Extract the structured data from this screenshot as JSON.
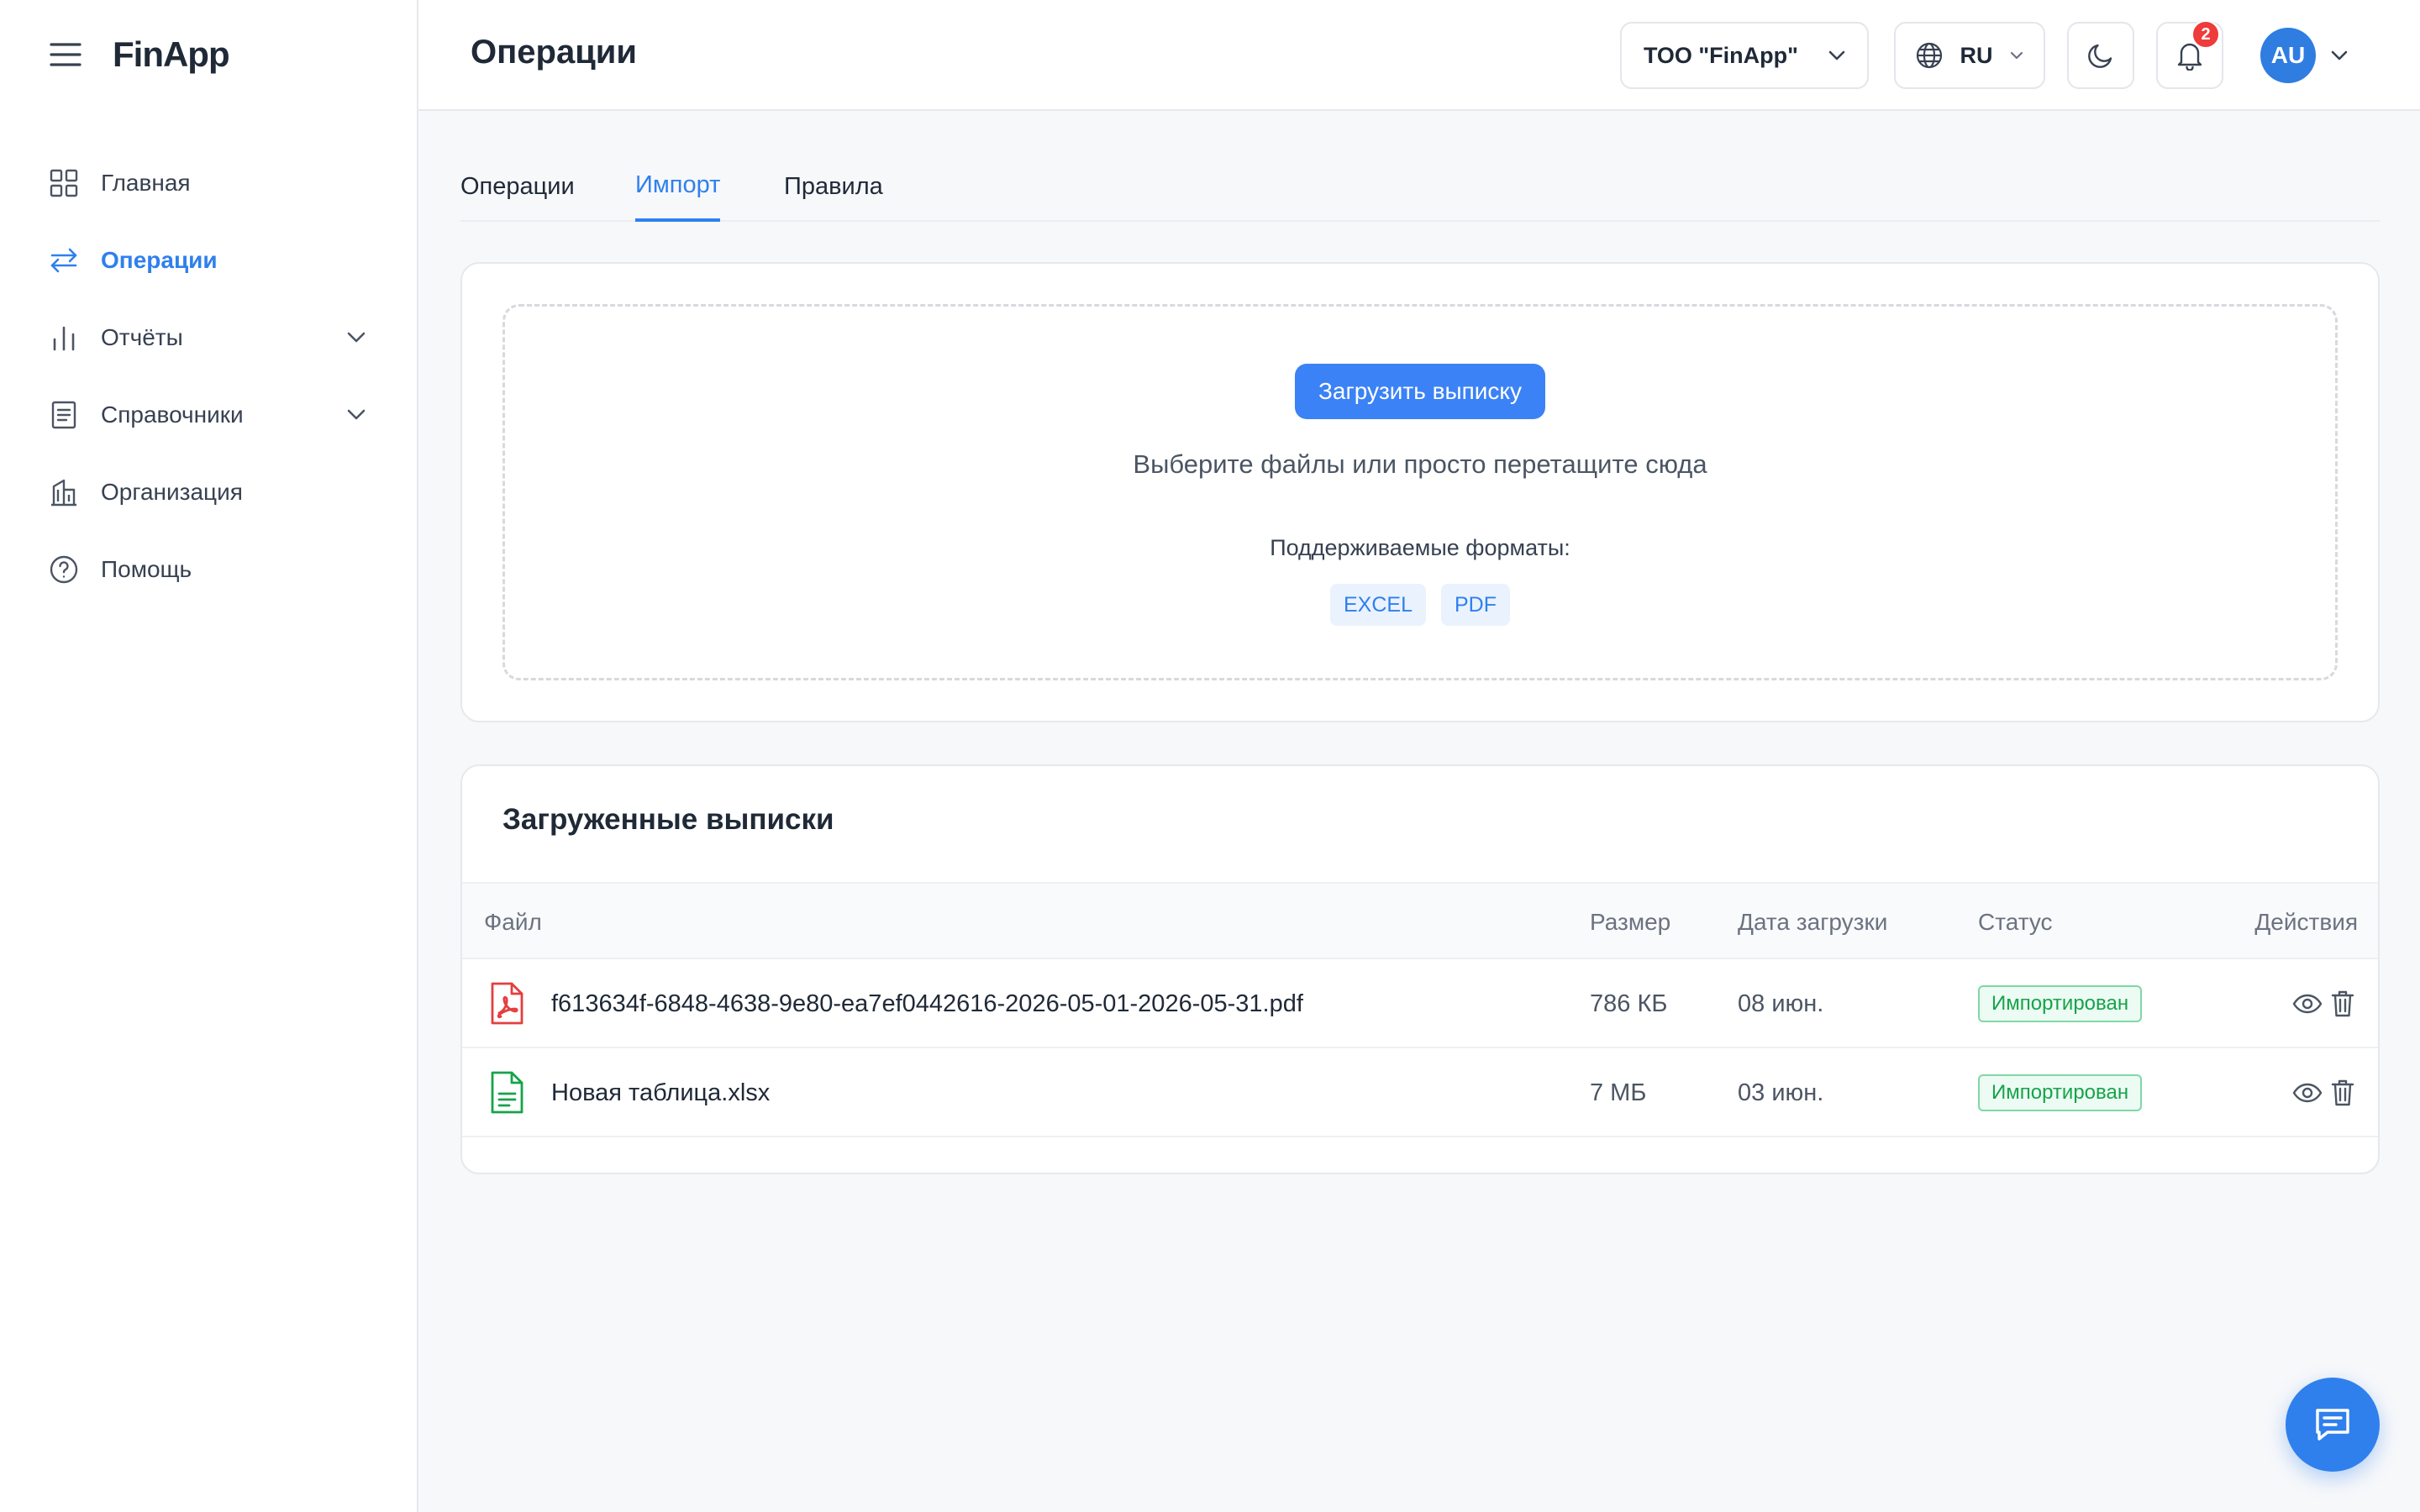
{
  "app": {
    "logo": "FinApp"
  },
  "sidebar": {
    "items": [
      {
        "label": "Главная",
        "icon": "grid-icon"
      },
      {
        "label": "Операции",
        "icon": "arrows-icon",
        "active": true
      },
      {
        "label": "Отчёты",
        "icon": "bar-chart-icon",
        "has_children": true
      },
      {
        "label": "Справочники",
        "icon": "book-icon",
        "has_children": true
      },
      {
        "label": "Организация",
        "icon": "building-icon"
      },
      {
        "label": "Помощь",
        "icon": "help-circle-icon"
      }
    ]
  },
  "header": {
    "title": "Операции",
    "org_select": "ТОО \"FinApp\"",
    "lang_select": "RU",
    "notifications_count": "2",
    "user_initials": "AU"
  },
  "tabs": [
    {
      "label": "Операции"
    },
    {
      "label": "Импорт",
      "active": true
    },
    {
      "label": "Правила"
    }
  ],
  "upload": {
    "button_label": "Загрузить выписку",
    "hint": "Выберите файлы или просто перетащите сюда",
    "formats_label": "Поддерживаемые форматы:",
    "formats": [
      "EXCEL",
      "PDF"
    ]
  },
  "statements": {
    "title": "Загруженные выписки",
    "columns": {
      "file": "Файл",
      "size": "Размер",
      "date": "Дата загрузки",
      "status": "Статус",
      "actions": "Действия"
    },
    "rows": [
      {
        "file": "f613634f-6848-4638-9e80-ea7ef0442616-2026-05-01-2026-05-31.pdf",
        "file_type": "pdf",
        "size": "786 КБ",
        "date": "08 июн.",
        "status": "Импортирован"
      },
      {
        "file": "Новая таблица.xlsx",
        "file_type": "xlsx",
        "size": "7 МБ",
        "date": "03 июн.",
        "status": "Импортирован"
      }
    ]
  },
  "colors": {
    "accent": "#2f80ed",
    "button": "#3b82f6",
    "success": "#16a34a",
    "danger": "#ef3b3b",
    "pdf_icon": "#e53e3e",
    "xlsx_icon": "#16a34a"
  }
}
